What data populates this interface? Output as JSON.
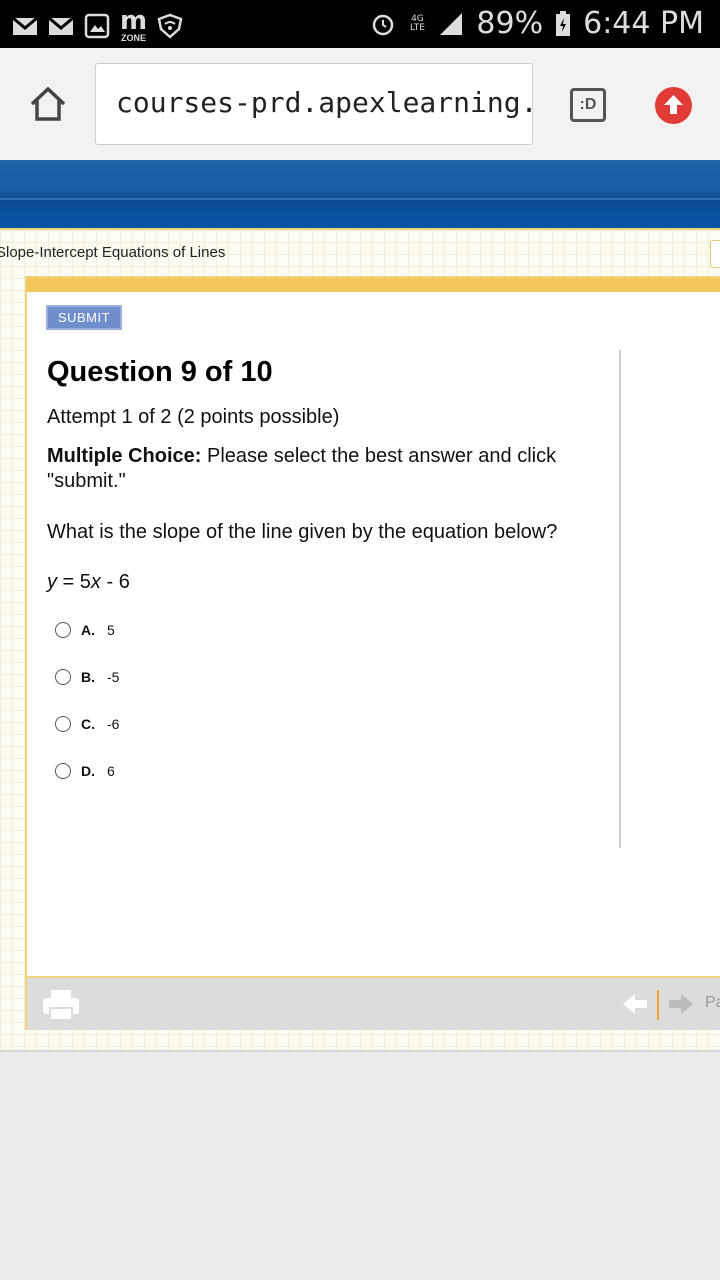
{
  "status_bar": {
    "battery": "89%",
    "time": "6:44 PM",
    "network": "4G LTE",
    "app_badge": "ZONE"
  },
  "browser": {
    "url": "courses-prd.apexlearning.com,",
    "tabs_label": ":D"
  },
  "lesson": {
    "title": "Slope-Intercept Equations of Lines"
  },
  "question": {
    "submit_label": "SUBMIT",
    "title": "Question 9 of 10",
    "attempt": "Attempt 1 of 2 (2 points possible)",
    "mc_label": "Multiple Choice:",
    "mc_instructions": " Please select the best answer and click \"submit.\"",
    "prompt": "What is the slope of the line given by the equation below?",
    "equation_var_y": "y",
    "equation_mid": " = 5",
    "equation_var_x": "x",
    "equation_end": " - 6",
    "choices": [
      {
        "letter": "A.",
        "text": "5"
      },
      {
        "letter": "B.",
        "text": "-5"
      },
      {
        "letter": "C.",
        "text": "-6"
      },
      {
        "letter": "D.",
        "text": "6"
      }
    ]
  },
  "footer": {
    "nav_label": "Pa"
  },
  "colors": {
    "banner": "#0b4d95",
    "panel_accent": "#f2c75c",
    "submit_bg": "#6f8ecb",
    "upload_btn": "#e03b36"
  }
}
